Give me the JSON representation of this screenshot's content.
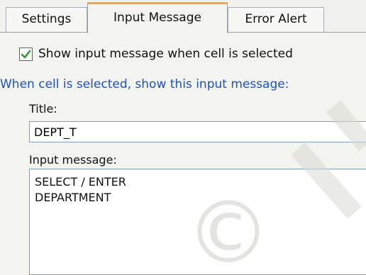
{
  "tabs": [
    {
      "label": "Settings",
      "active": false
    },
    {
      "label": "Input Message",
      "active": true
    },
    {
      "label": "Error Alert",
      "active": false
    }
  ],
  "show_input_checkbox": {
    "checked": true,
    "label": "Show input message when cell is selected"
  },
  "section_label": "When cell is selected, show this input message:",
  "title_field": {
    "label": "Title:",
    "value": "DEPT_T"
  },
  "input_message_field": {
    "label": "Input message:",
    "value": "SELECT / ENTER\nDEPARTMENT"
  },
  "watermark": {
    "glyph": "©",
    "color": "#d8d8d4"
  },
  "colors": {
    "active_tab_accent": "#f0a93a",
    "section_label": "#1b53c4",
    "checkmark": "#2e9d2e"
  }
}
